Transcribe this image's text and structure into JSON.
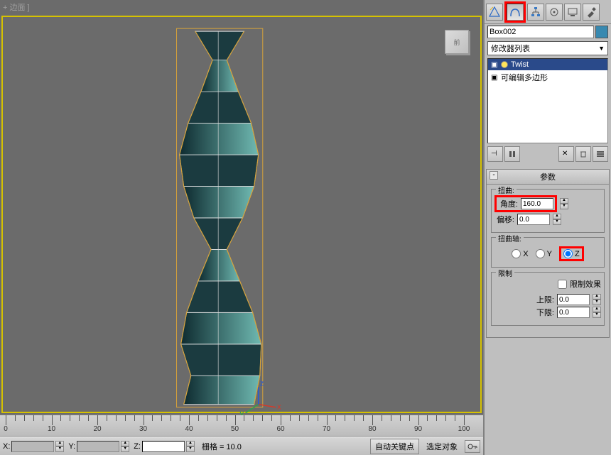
{
  "viewport": {
    "label": "+ 边面 ]",
    "viewcube_face": "前"
  },
  "cmd_tabs": [
    {
      "name": "create-tab",
      "selected": false
    },
    {
      "name": "modify-tab",
      "selected": true
    },
    {
      "name": "hierarchy-tab",
      "selected": false
    },
    {
      "name": "motion-tab",
      "selected": false
    },
    {
      "name": "display-tab",
      "selected": false
    },
    {
      "name": "utilities-tab",
      "selected": false
    }
  ],
  "object_name": "Box002",
  "modifier_dropdown": "修改器列表",
  "mod_stack": [
    {
      "label": "Twist",
      "selected": true,
      "expandable": true,
      "lit": true
    },
    {
      "label": "可编辑多边形",
      "selected": false,
      "expandable": true,
      "lit": false
    }
  ],
  "params": {
    "title": "参数",
    "twist_group": "扭曲:",
    "angle_label": "角度:",
    "angle_value": "160.0",
    "bias_label": "偏移:",
    "bias_value": "0.0",
    "axis_group": "扭曲轴:",
    "axis_x": "X",
    "axis_y": "Y",
    "axis_z": "Z",
    "axis_selected": "Z",
    "limit_group": "限制",
    "limit_effect": "限制效果",
    "upper_label": "上限:",
    "upper_value": "0.0",
    "lower_label": "下限:",
    "lower_value": "0.0"
  },
  "ruler": {
    "majors": [
      0,
      10,
      20,
      30,
      40,
      50,
      60,
      70,
      80,
      90,
      100
    ]
  },
  "status": {
    "x_label": "X:",
    "y_label": "Y:",
    "z_label": "Z:",
    "x_value": "",
    "y_value": "",
    "z_value": "",
    "grid_label": "栅格 = 10.0",
    "auto_key": "自动关键点",
    "selection": "选定对象"
  }
}
